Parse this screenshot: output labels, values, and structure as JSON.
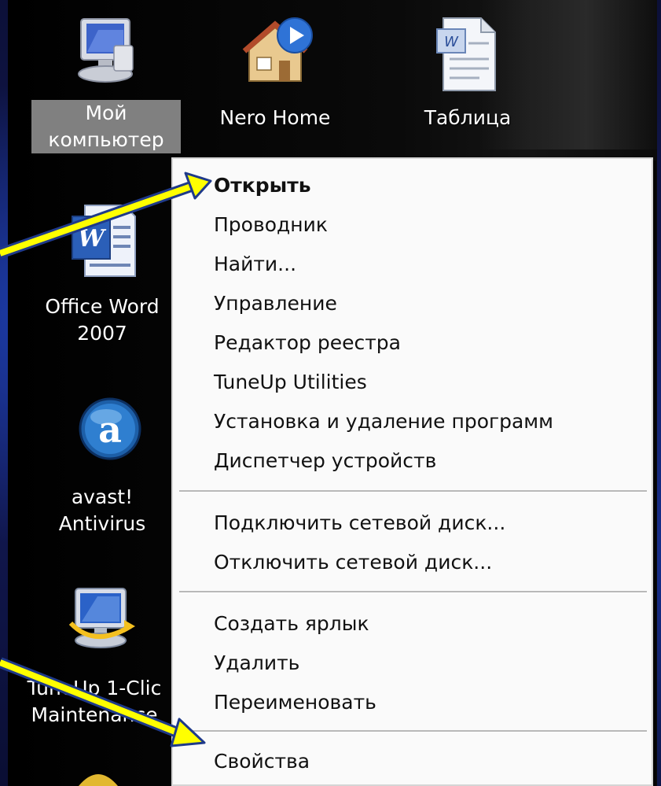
{
  "desktop": {
    "icons": [
      {
        "label": "Мой\nкомпьютер",
        "icon": "my-computer-icon",
        "selected": true
      },
      {
        "label": "Nero Home",
        "icon": "nero-home-icon",
        "selected": false
      },
      {
        "label": "Таблица",
        "icon": "word-document-icon",
        "selected": false
      },
      {
        "label": "Office Word\n2007",
        "icon": "office-word-icon",
        "selected": false
      },
      {
        "label": "avast!\nAntivirus",
        "icon": "avast-icon",
        "selected": false
      },
      {
        "label": "TuneUp 1-Clic\nMaintenance",
        "icon": "tuneup-icon",
        "selected": false
      }
    ]
  },
  "context_menu": {
    "groups": [
      [
        {
          "label": "Открыть",
          "bold": true
        },
        {
          "label": "Проводник"
        },
        {
          "label": "Найти..."
        },
        {
          "label": "Управление"
        },
        {
          "label": "Редактор реестра"
        },
        {
          "label": "TuneUp Utilities"
        },
        {
          "label": "Установка и удаление программ"
        },
        {
          "label": "Диспетчер устройств"
        }
      ],
      [
        {
          "label": "Подключить сетевой диск..."
        },
        {
          "label": "Отключить сетевой диск..."
        }
      ],
      [
        {
          "label": "Создать ярлык"
        },
        {
          "label": "Удалить"
        },
        {
          "label": "Переименовать"
        }
      ],
      [
        {
          "label": "Свойства"
        }
      ]
    ]
  },
  "colors": {
    "background": "#0d1340",
    "arrow_fill": "#ffff00",
    "arrow_outline": "#1f3a8a",
    "selection": "#808080"
  }
}
